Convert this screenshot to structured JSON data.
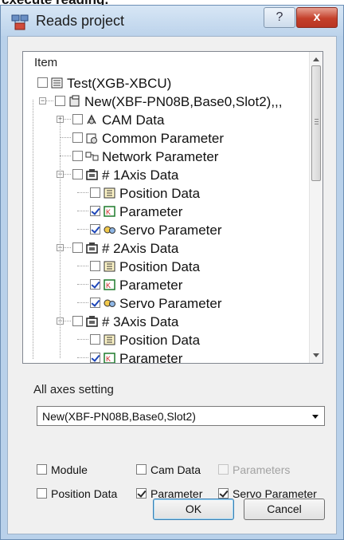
{
  "behind_text": "cxecute reading.",
  "window": {
    "title": "Reads project",
    "help_label": "?",
    "close_label": "x"
  },
  "tree": {
    "header": "Item",
    "rows": [
      {
        "label": "Test(XGB-XBCU)",
        "checked": false,
        "icon": "plc-icon"
      },
      {
        "label": "New(XBF-PN08B,Base0,Slot2),,,",
        "checked": false,
        "icon": "module-icon"
      },
      {
        "label": "CAM Data",
        "checked": false,
        "icon": "cam-data-icon"
      },
      {
        "label": "Common Parameter",
        "checked": false,
        "icon": "common-parameter-icon"
      },
      {
        "label": "Network Parameter",
        "checked": false,
        "icon": "network-parameter-icon"
      },
      {
        "label": "# 1Axis Data",
        "checked": false,
        "icon": "axis-data-icon"
      },
      {
        "label": "Position Data",
        "checked": false,
        "icon": "position-data-icon"
      },
      {
        "label": "Parameter",
        "checked": true,
        "icon": "parameter-icon"
      },
      {
        "label": "Servo Parameter",
        "checked": true,
        "icon": "servo-parameter-icon"
      },
      {
        "label": "# 2Axis Data",
        "checked": false,
        "icon": "axis-data-icon"
      },
      {
        "label": "Position Data",
        "checked": false,
        "icon": "position-data-icon"
      },
      {
        "label": "Parameter",
        "checked": true,
        "icon": "parameter-icon"
      },
      {
        "label": "Servo Parameter",
        "checked": true,
        "icon": "servo-parameter-icon"
      },
      {
        "label": "# 3Axis Data",
        "checked": false,
        "icon": "axis-data-icon"
      },
      {
        "label": "Position Data",
        "checked": false,
        "icon": "position-data-icon"
      },
      {
        "label": "Parameter",
        "checked": true,
        "icon": "parameter-icon"
      }
    ]
  },
  "all_axes": {
    "label": "All axes setting",
    "selected": "New(XBF-PN08B,Base0,Slot2)",
    "options": [
      {
        "label": "Module",
        "checked": false,
        "enabled": true
      },
      {
        "label": "Cam Data",
        "checked": false,
        "enabled": true
      },
      {
        "label": "Parameters",
        "checked": false,
        "enabled": false
      },
      {
        "label": "Position Data",
        "checked": false,
        "enabled": true
      },
      {
        "label": "Parameter",
        "checked": true,
        "enabled": true
      },
      {
        "label": "Servo Parameter",
        "checked": true,
        "enabled": true
      }
    ]
  },
  "buttons": {
    "ok": "OK",
    "cancel": "Cancel"
  },
  "colors": {
    "frame": "#b9d1ea",
    "close": "#c4402b",
    "check": "#1d46b8"
  }
}
